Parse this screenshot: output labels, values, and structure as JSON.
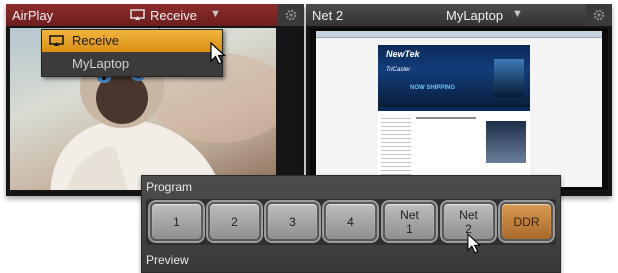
{
  "left_panel": {
    "name": "AirPlay",
    "source": "Receive",
    "header_color": "#7d2525",
    "dropdown": {
      "items": [
        {
          "label": "Receive",
          "selected": true
        },
        {
          "label": "MyLaptop",
          "selected": false
        }
      ]
    }
  },
  "right_panel": {
    "name": "Net 2",
    "source": "MyLaptop",
    "site_logo": "NewTek",
    "banner_tag": "NOW SHIPPING",
    "banner_logo": "TriCaster"
  },
  "switcher": {
    "program_label": "Program",
    "preview_label": "Preview",
    "buttons": [
      "1",
      "2",
      "3",
      "4",
      "Net\n1",
      "Net\n2",
      "DDR"
    ],
    "ddr_color": "#c4843e"
  }
}
